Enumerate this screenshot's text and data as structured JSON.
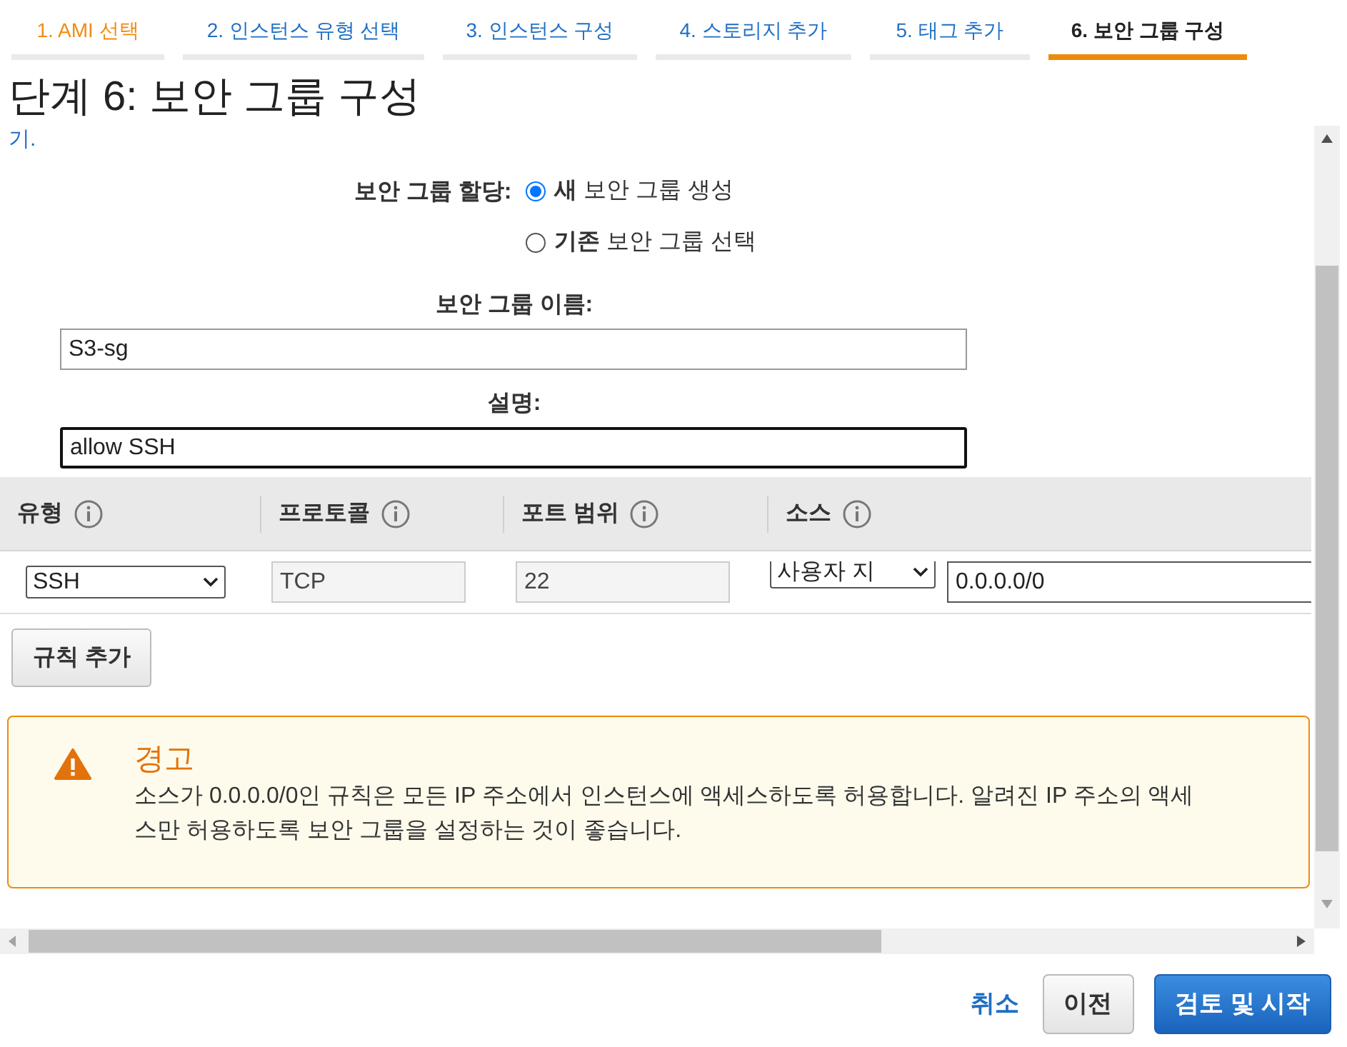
{
  "steps": [
    {
      "label": "1. AMI 선택",
      "visited": true,
      "selected": false
    },
    {
      "label": "2. 인스턴스 유형 선택",
      "visited": false,
      "selected": false
    },
    {
      "label": "3. 인스턴스 구성",
      "visited": false,
      "selected": false
    },
    {
      "label": "4. 스토리지 추가",
      "visited": false,
      "selected": false
    },
    {
      "label": "5. 태그 추가",
      "visited": false,
      "selected": false
    },
    {
      "label": "6. 보안 그룹 구성",
      "visited": false,
      "selected": true
    }
  ],
  "heading": "단계 6: 보안 그룹 구성",
  "intro_tail": "기.",
  "assignment": {
    "label": "보안 그룹 할당:",
    "options": [
      {
        "label": "**새** 보안 그룹 생성",
        "selected": true
      },
      {
        "label": "**기존** 보안 그룹 선택",
        "selected": false
      }
    ]
  },
  "fields": [
    {
      "label": "보안 그룹 이름:",
      "value": "S3-sg",
      "focused": false
    },
    {
      "label": "설명:",
      "value": "allow SSH",
      "focused": true
    }
  ],
  "rules_table": {
    "columns": [
      "유형",
      "프로토콜",
      "포트 범위",
      "소스"
    ],
    "rows": [
      {
        "type": "SSH",
        "protocol": "TCP",
        "port_range": "22",
        "source_kind": "사용자 지",
        "source": "0.0.0.0/0"
      }
    ]
  },
  "add_rule_button": "규칙 추가",
  "warning": {
    "title": "경고",
    "message": "소스가 0.0.0.0/0인 규칙은 모든 IP 주소에서 인스턴스에 액세스하도록 허용합니다. 알려진 IP 주소의 액세스만 허용하도록 보안 그룹을 설정하는 것이 좋습니다."
  },
  "footer": {
    "cancel": "취소",
    "previous": "이전",
    "review": "검토 및 시작"
  }
}
